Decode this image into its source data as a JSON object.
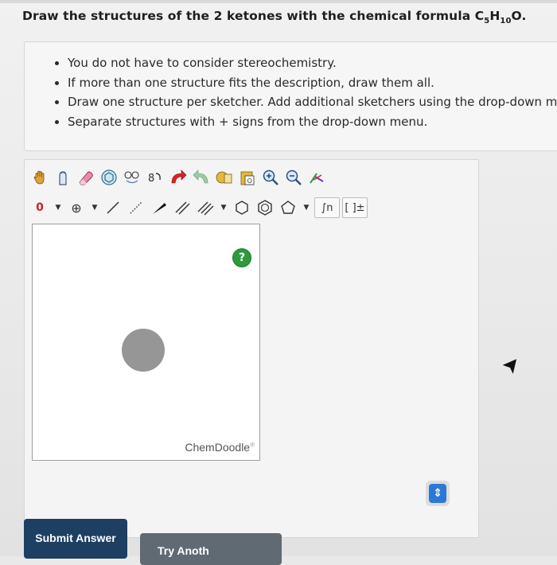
{
  "question": {
    "title": "Draw the structures of the 2 ketones with the chemical formula C",
    "formula": {
      "c_count": "5",
      "h": "H",
      "h_count": "10",
      "o": "O."
    }
  },
  "instructions": [
    "You do not have to consider stereochemistry.",
    "If more than one structure fits the description, draw them all.",
    "Draw one structure per sketcher. Add additional sketchers using the drop-down m",
    "Separate structures with + signs from the drop-down menu."
  ],
  "toolbar": {
    "charge_value": "0",
    "charge_plus": "⊕",
    "template_label": "∫n",
    "bracket_label": "[ ]±"
  },
  "sketcher": {
    "help_label": "?",
    "brand": "ChemDoodle",
    "brand_mark": "®"
  },
  "toggle_label": "⇕",
  "buttons": {
    "submit": "Submit Answer",
    "try_another": "Try Anoth"
  },
  "icons": [
    "hand-icon",
    "lasso-icon",
    "eraser-icon",
    "ring-select-icon",
    "clear-icon",
    "undo-icon",
    "redo-icon",
    "copy-icon",
    "paste-icon",
    "zoom-in-icon",
    "zoom-out-icon",
    "clean-icon",
    "single-bond-icon",
    "dashed-bond-icon",
    "wedge-bond-icon",
    "double-bond-icon",
    "triple-bond-icon",
    "hexagon-ring-icon",
    "benzene-ring-icon",
    "pentagon-ring-icon",
    "help-icon",
    "cursor-icon"
  ],
  "colors": {
    "help_green": "#2d9a3c",
    "toggle_blue": "#2a79d6",
    "submit_navy": "#1d3f62",
    "try_gray": "#5f6a73"
  }
}
